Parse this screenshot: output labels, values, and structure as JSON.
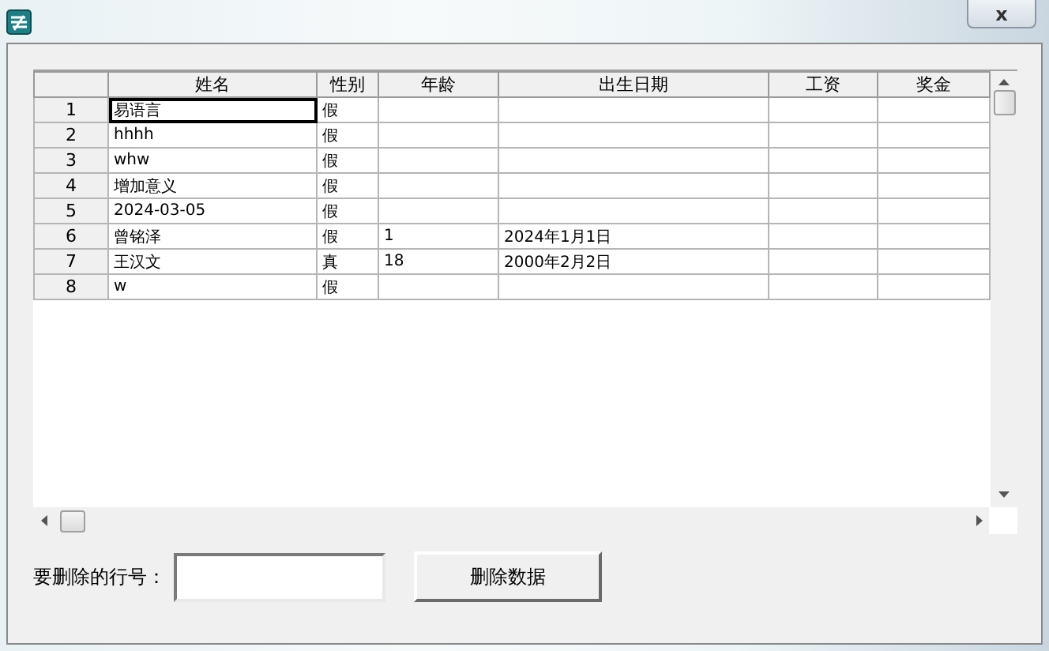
{
  "window": {
    "close_label": "x"
  },
  "table": {
    "columns": [
      "姓名",
      "性别",
      "年龄",
      "出生日期",
      "工资",
      "奖金"
    ],
    "rows": [
      {
        "number": "1",
        "selected": true,
        "cells": [
          "易语言",
          "假",
          null,
          null,
          null,
          null
        ]
      },
      {
        "number": "2",
        "selected": false,
        "cells": [
          "hhhh",
          "假",
          null,
          null,
          null,
          null
        ]
      },
      {
        "number": "3",
        "selected": false,
        "cells": [
          "whw",
          "假",
          null,
          null,
          null,
          null
        ]
      },
      {
        "number": "4",
        "selected": false,
        "cells": [
          "增加意义",
          "假",
          null,
          null,
          null,
          null
        ]
      },
      {
        "number": "5",
        "selected": false,
        "cells": [
          "2024-03-05",
          "假",
          null,
          null,
          null,
          null
        ]
      },
      {
        "number": "6",
        "selected": false,
        "cells": [
          "曾铭泽",
          "假",
          "1",
          "2024年1月1日",
          null,
          null
        ]
      },
      {
        "number": "7",
        "selected": false,
        "cells": [
          "王汉文",
          "真",
          "18",
          "2000年2月2日",
          null,
          null
        ]
      },
      {
        "number": "8",
        "selected": false,
        "cells": [
          "w",
          "假",
          null,
          null,
          null,
          null
        ]
      }
    ]
  },
  "delete_form": {
    "label": "要删除的行号：",
    "button": "删除数据"
  }
}
